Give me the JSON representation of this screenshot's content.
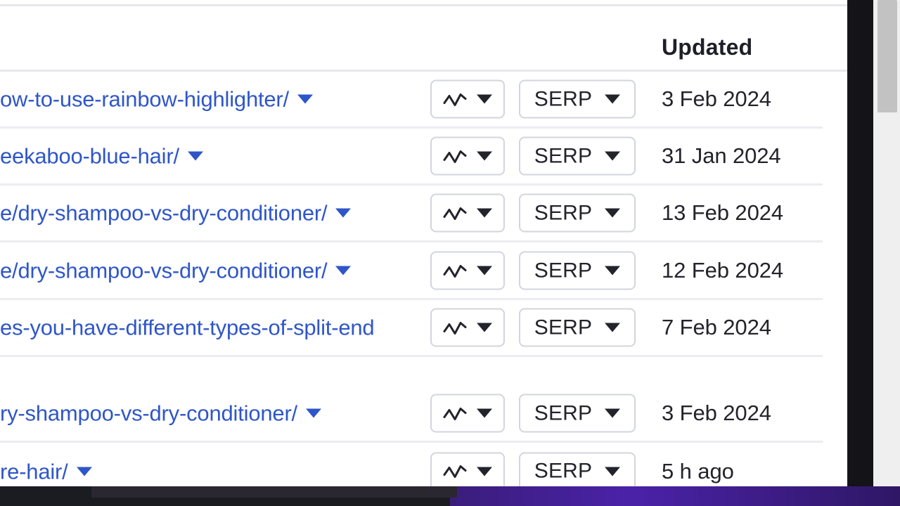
{
  "window": {
    "app": "rank-tracker-table",
    "zoomed": true
  },
  "scrollbar": {
    "name": "vertical-scrollbar",
    "thumb_position_pct": 0
  },
  "table": {
    "columns": [
      {
        "key": "url",
        "label": ""
      },
      {
        "key": "metrics",
        "label": ""
      },
      {
        "key": "serp",
        "label": ""
      },
      {
        "key": "updated",
        "label": "Updated"
      }
    ],
    "header": {
      "updated_label": "Updated"
    },
    "buttons": {
      "chart_icon": "line-chart-icon",
      "dropdown_icon": "chevron-down-icon",
      "serp_label": "SERP"
    },
    "rows": [
      {
        "url": "ow-to-use-rainbow-highlighter/",
        "has_caret": true,
        "metrics_label": "",
        "serp_label": "SERP",
        "updated": "3 Feb 2024"
      },
      {
        "url": "eekaboo-blue-hair/",
        "has_caret": true,
        "metrics_label": "",
        "serp_label": "SERP",
        "updated": "31 Jan 2024"
      },
      {
        "url": "e/dry-shampoo-vs-dry-conditioner/",
        "has_caret": true,
        "metrics_label": "",
        "serp_label": "SERP",
        "updated": "13 Feb 2024"
      },
      {
        "url": "e/dry-shampoo-vs-dry-conditioner/",
        "has_caret": true,
        "metrics_label": "",
        "serp_label": "SERP",
        "updated": "12 Feb 2024"
      },
      {
        "url": "es-you-have-different-types-of-split-end",
        "has_caret": false,
        "metrics_label": "",
        "serp_label": "SERP",
        "updated": "7 Feb 2024"
      },
      {
        "url": "ry-shampoo-vs-dry-conditioner/",
        "has_caret": true,
        "metrics_label": "",
        "serp_label": "SERP",
        "updated": "3 Feb 2024"
      },
      {
        "url": "re-hair/",
        "has_caret": true,
        "metrics_label": "",
        "serp_label": "SERP",
        "updated": "5 h ago"
      }
    ]
  },
  "colors": {
    "link": "#2f56c8",
    "text": "#23232c",
    "border": "#ececf1",
    "panel": "#ffffff",
    "scrollbar_track": "#efefef",
    "scrollbar_thumb": "#c2c2c2"
  }
}
